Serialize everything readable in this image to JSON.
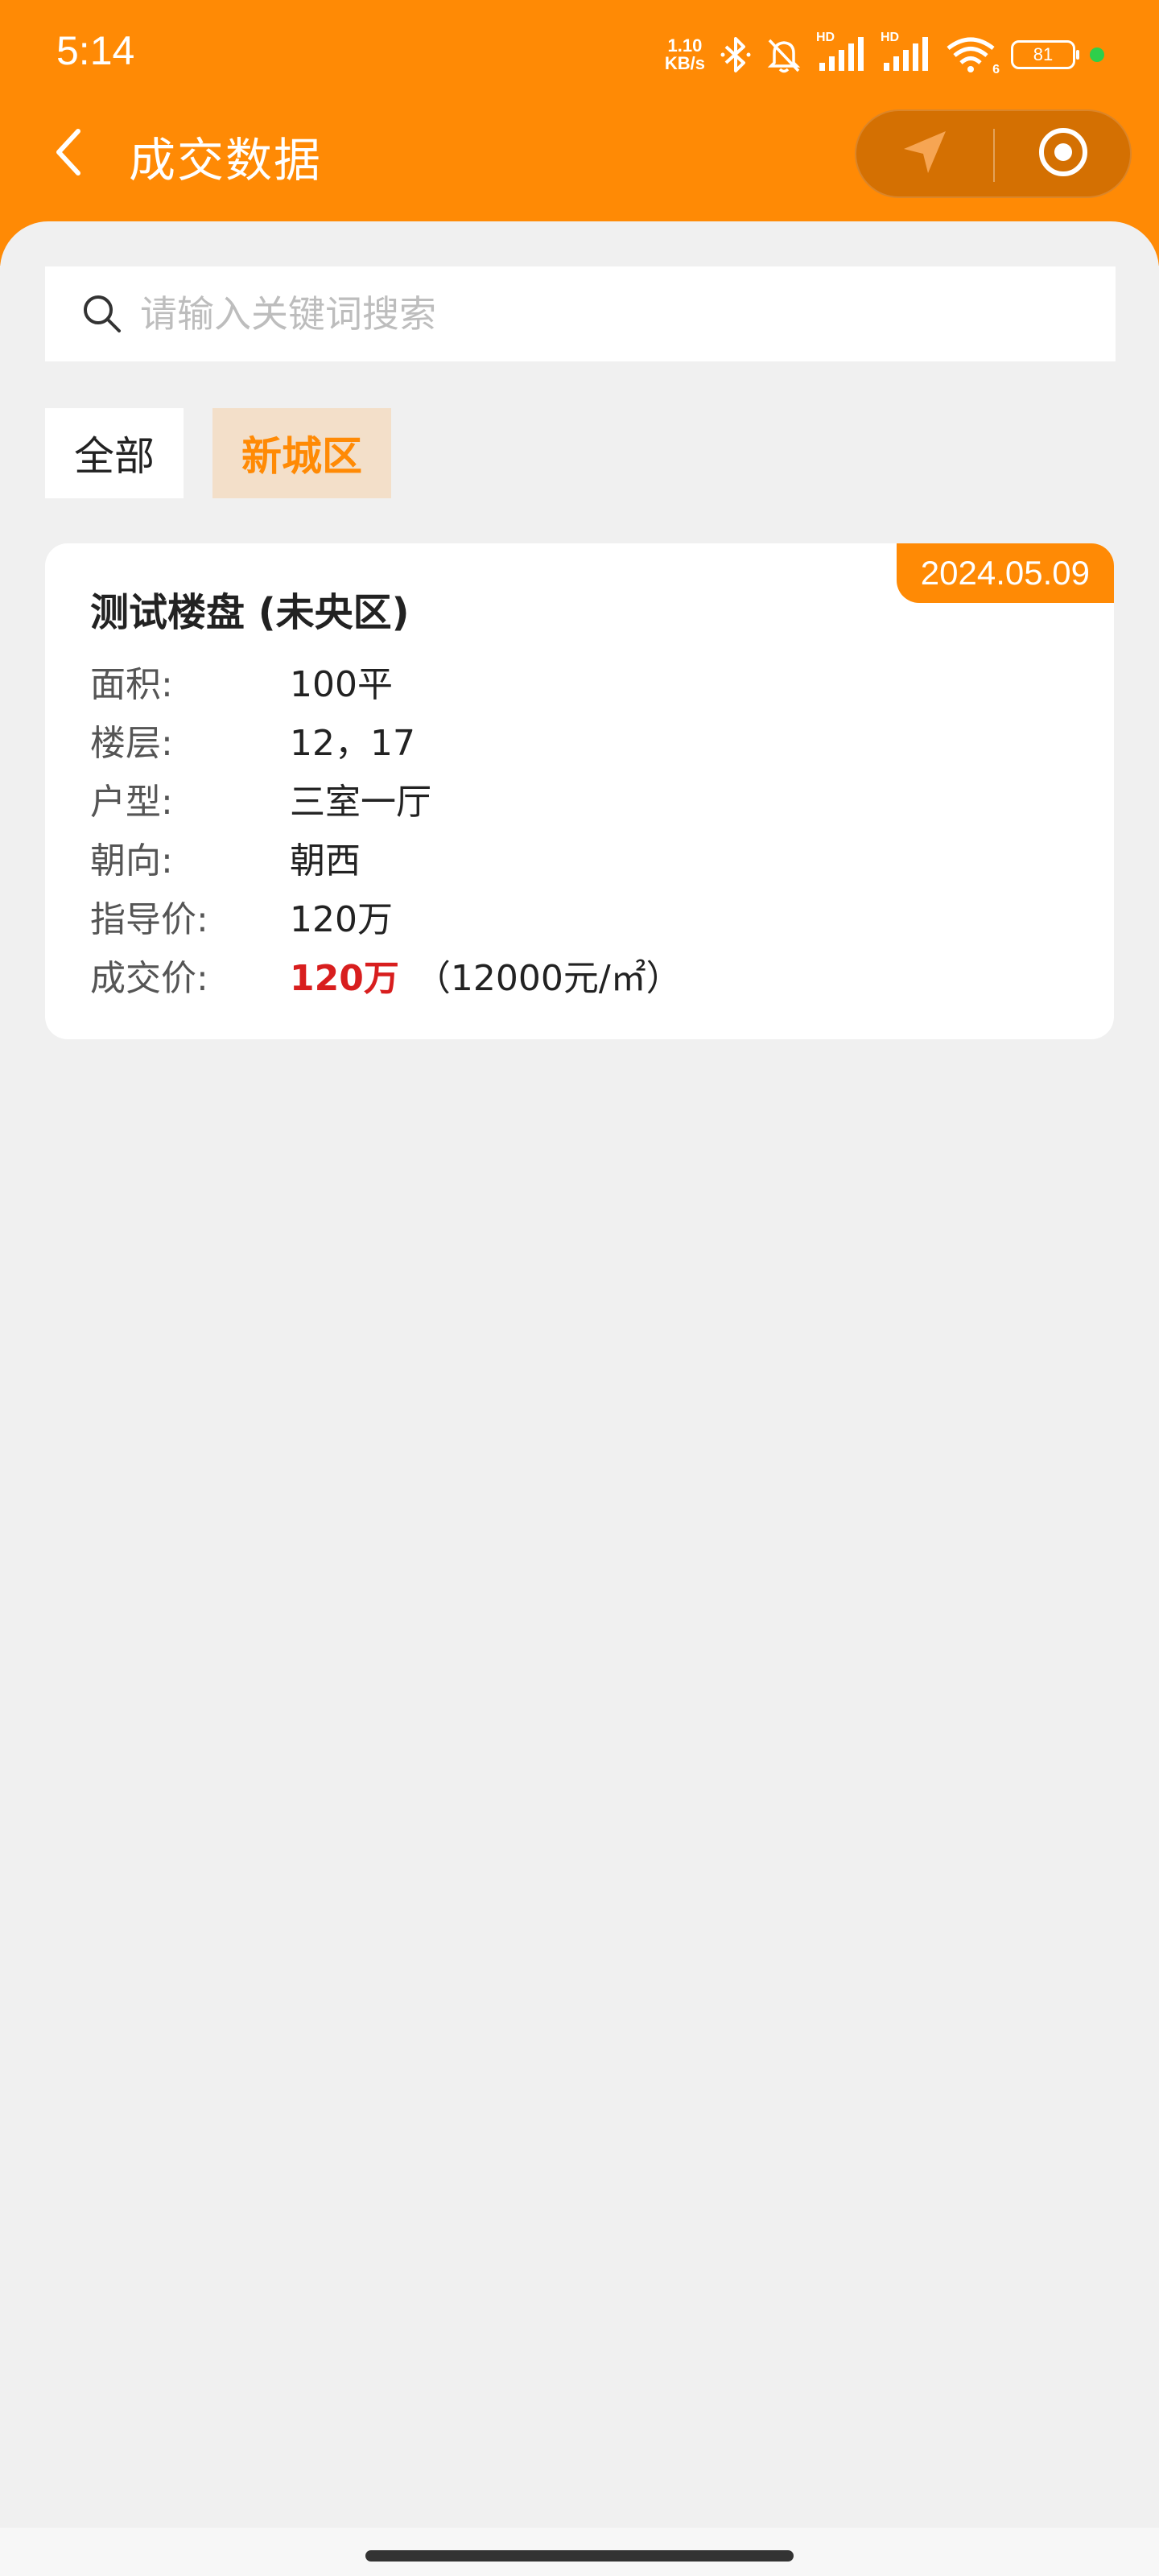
{
  "status_bar": {
    "time": "5:14",
    "net_speed_value": "1.10",
    "net_speed_unit": "KB/s",
    "signal_label_1": "HD",
    "signal_label_2": "HD",
    "wifi_label": "6",
    "battery_level": "81",
    "icons": [
      "bluetooth-icon",
      "mute-bell-icon",
      "signal-icon",
      "signal-icon",
      "wifi-icon",
      "battery-icon"
    ],
    "indicator_color": "#2ecf4b"
  },
  "header": {
    "title": "成交数据",
    "background_color": "#ff8a05",
    "back_icon": "chevron-left-icon",
    "capsule_icons": [
      "navigation-arrow-icon",
      "record-target-icon"
    ]
  },
  "search": {
    "placeholder": "请输入关键词搜索",
    "value": ""
  },
  "filters": [
    {
      "label": "全部",
      "active": false
    },
    {
      "label": "新城区",
      "active": true
    }
  ],
  "records": [
    {
      "date": "2024.05.09",
      "title": "测试楼盘 (未央区)",
      "fields": [
        {
          "label": "面积:",
          "value": "100平"
        },
        {
          "label": "楼层:",
          "value": "12，17"
        },
        {
          "label": "户型:",
          "value": "三室一厅"
        },
        {
          "label": "朝向:",
          "value": "朝西"
        },
        {
          "label": "指导价:",
          "value": "120万"
        }
      ],
      "deal_price_label": "成交价:",
      "deal_price": "120万",
      "unit_price": "（12000元/㎡）"
    }
  ],
  "colors": {
    "accent": "#ff8a05",
    "price_red": "#d81e1e",
    "active_tab_bg": "#f3dfc9"
  }
}
